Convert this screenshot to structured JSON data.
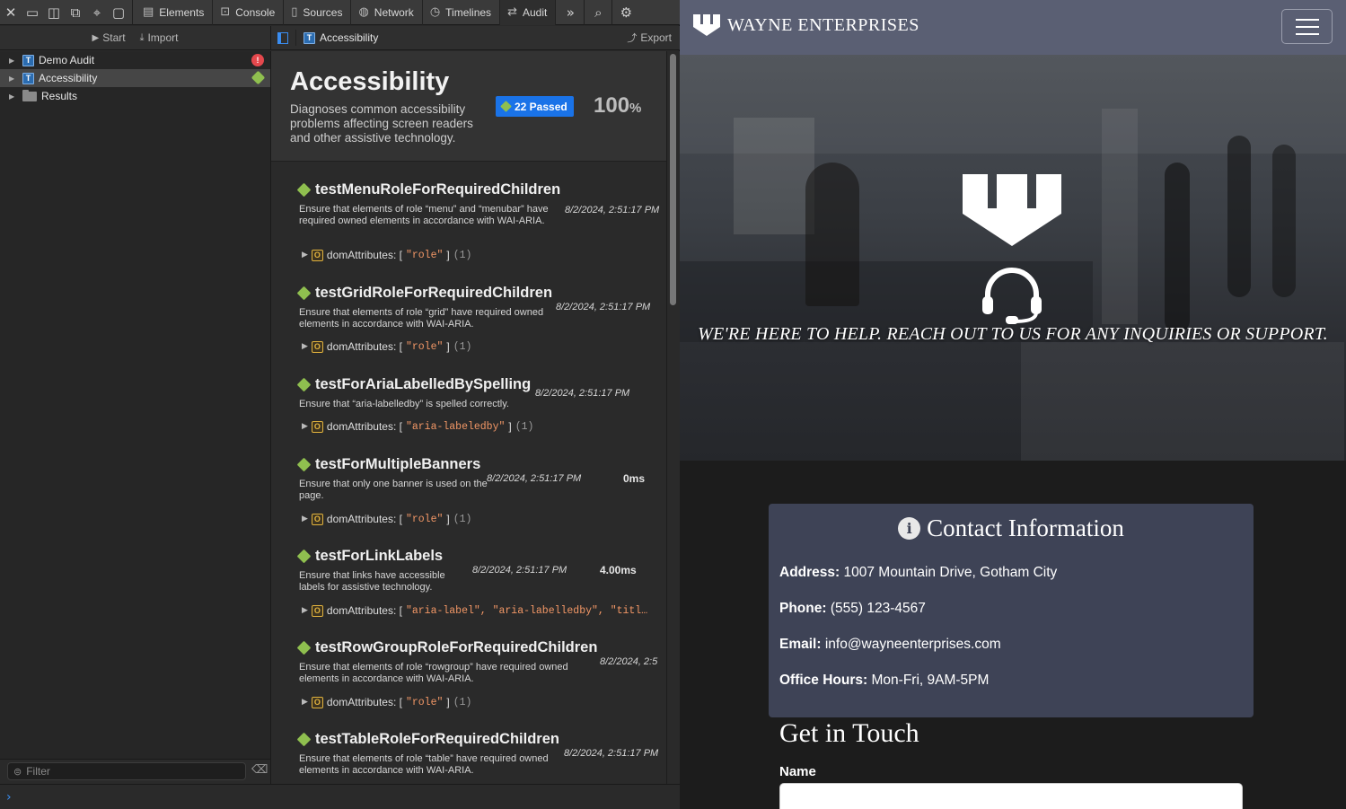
{
  "toolbar": {
    "tabs": [
      {
        "label": "Elements"
      },
      {
        "label": "Console"
      },
      {
        "label": "Sources"
      },
      {
        "label": "Network"
      },
      {
        "label": "Timelines"
      },
      {
        "label": "Audit"
      }
    ]
  },
  "subbar": {
    "start_label": "Start",
    "import_label": "Import",
    "current_label": "Accessibility",
    "export_label": "Export"
  },
  "tree": {
    "items": [
      {
        "label": "Demo Audit",
        "status": "error"
      },
      {
        "label": "Accessibility",
        "status": "passed",
        "selected": true
      },
      {
        "label": "Results"
      }
    ]
  },
  "filter": {
    "placeholder": "Filter"
  },
  "audit": {
    "title": "Accessibility",
    "description": "Diagnoses common accessibility problems affecting screen readers and other assistive technology.",
    "passed_badge": "22 Passed",
    "percent": "100",
    "percent_sign": "%",
    "tests": [
      {
        "name": "testMenuRoleForRequiredChildren",
        "description": "Ensure that elements of role “menu” and “menubar” have required owned elements in accordance with WAI-ARIA.",
        "time": "8/2/2024, 2:51:17 PM",
        "duration": "",
        "attr_label": "domAttributes: [",
        "attr_values": "\"role\"",
        "attr_close": "]",
        "count": "(1)"
      },
      {
        "name": "testGridRoleForRequiredChildren",
        "description": "Ensure that elements of role “grid” have required owned elements in accordance with WAI-ARIA.",
        "time": "8/2/2024, 2:51:17 PM",
        "duration": "",
        "attr_label": "domAttributes: [",
        "attr_values": "\"role\"",
        "attr_close": "]",
        "count": "(1)"
      },
      {
        "name": "testForAriaLabelledBySpelling",
        "description": "Ensure that “aria-labelledby” is spelled correctly.",
        "time": "8/2/2024, 2:51:17 PM",
        "duration": "",
        "attr_label": "domAttributes: [",
        "attr_values": "\"aria-labeledby\"",
        "attr_close": "]",
        "count": "(1)"
      },
      {
        "name": "testForMultipleBanners",
        "description": "Ensure that only one banner is used on the page.",
        "time": "8/2/2024, 2:51:17 PM",
        "duration": "0ms",
        "attr_label": "domAttributes: [",
        "attr_values": "\"role\"",
        "attr_close": "]",
        "count": "(1)"
      },
      {
        "name": "testForLinkLabels",
        "description": "Ensure that links have accessible labels for assistive technology.",
        "time": "8/2/2024, 2:51:17 PM",
        "duration": "4.00ms",
        "attr_label": "domAttributes: [",
        "attr_values": "\"aria-label\", \"aria-labelledby\", \"titl…",
        "attr_close": "",
        "count": ""
      },
      {
        "name": "testRowGroupRoleForRequiredChildren",
        "description": "Ensure that elements of role “rowgroup” have required owned elements in accordance with WAI-ARIA.",
        "time": "8/2/2024, 2:5",
        "duration": "",
        "attr_label": "domAttributes: [",
        "attr_values": "\"role\"",
        "attr_close": "]",
        "count": "(1)"
      },
      {
        "name": "testTableRoleForRequiredChildren",
        "description": "Ensure that elements of role “table” have required owned elements in accordance with WAI-ARIA.",
        "time": "8/2/2024, 2:51:17 PM",
        "duration": "",
        "attr_label": "",
        "attr_values": "",
        "attr_close": "",
        "count": ""
      }
    ]
  },
  "site": {
    "brand": "WAYNE ENTERPRISES",
    "hero_text": "WE'RE HERE TO HELP. REACH OUT TO US FOR ANY INQUIRIES OR SUPPORT.",
    "contact": {
      "title": "Contact Information",
      "address_label": "Address:",
      "address": "1007 Mountain Drive, Gotham City",
      "phone_label": "Phone:",
      "phone": "(555) 123-4567",
      "email_label": "Email:",
      "email": "info@wayneenterprises.com",
      "hours_label": "Office Hours:",
      "hours": "Mon-Fri, 9AM-5PM"
    },
    "get_in_touch": "Get in Touch",
    "name_label": "Name"
  },
  "colors": {
    "accent_blue": "#1a73e8",
    "passed_green": "#8fbf4f",
    "error_red": "#e5484d",
    "nav_bg": "#5a5f73",
    "contact_bg": "#3e4356"
  }
}
